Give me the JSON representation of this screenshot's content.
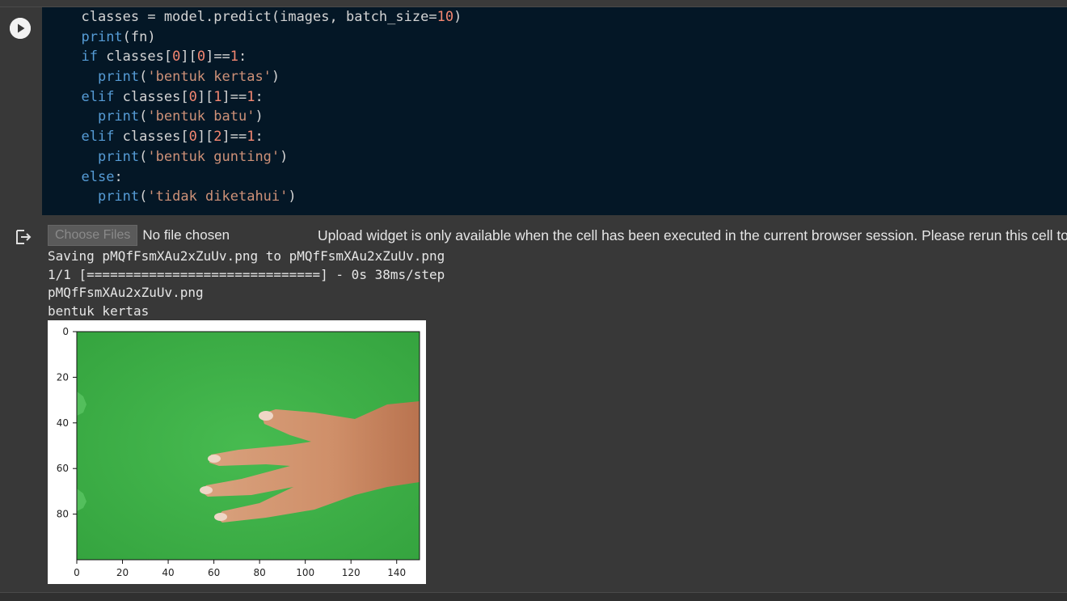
{
  "code_cell": {
    "run_button_icon": "play-icon",
    "lines": [
      [
        {
          "t": "  classes = model.predict(images, batch_size=",
          "c": "op"
        },
        {
          "t": "10",
          "c": "num"
        },
        {
          "t": ")",
          "c": "op"
        }
      ],
      [
        {
          "t": "  ",
          "c": "op"
        },
        {
          "t": "print",
          "c": "bi"
        },
        {
          "t": "(fn)",
          "c": "op"
        }
      ],
      [
        {
          "t": "  ",
          "c": "op"
        },
        {
          "t": "if",
          "c": "bi"
        },
        {
          "t": " classes[",
          "c": "op"
        },
        {
          "t": "0",
          "c": "num"
        },
        {
          "t": "][",
          "c": "op"
        },
        {
          "t": "0",
          "c": "num"
        },
        {
          "t": "]==",
          "c": "op"
        },
        {
          "t": "1",
          "c": "num"
        },
        {
          "t": ":",
          "c": "op"
        }
      ],
      [
        {
          "t": "    ",
          "c": "op"
        },
        {
          "t": "print",
          "c": "bi"
        },
        {
          "t": "(",
          "c": "op"
        },
        {
          "t": "'bentuk kertas'",
          "c": "str"
        },
        {
          "t": ")",
          "c": "op"
        }
      ],
      [
        {
          "t": "  ",
          "c": "op"
        },
        {
          "t": "elif",
          "c": "bi"
        },
        {
          "t": " classes[",
          "c": "op"
        },
        {
          "t": "0",
          "c": "num"
        },
        {
          "t": "][",
          "c": "op"
        },
        {
          "t": "1",
          "c": "num"
        },
        {
          "t": "]==",
          "c": "op"
        },
        {
          "t": "1",
          "c": "num"
        },
        {
          "t": ":",
          "c": "op"
        }
      ],
      [
        {
          "t": "    ",
          "c": "op"
        },
        {
          "t": "print",
          "c": "bi"
        },
        {
          "t": "(",
          "c": "op"
        },
        {
          "t": "'bentuk batu'",
          "c": "str"
        },
        {
          "t": ")",
          "c": "op"
        }
      ],
      [
        {
          "t": "  ",
          "c": "op"
        },
        {
          "t": "elif",
          "c": "bi"
        },
        {
          "t": " classes[",
          "c": "op"
        },
        {
          "t": "0",
          "c": "num"
        },
        {
          "t": "][",
          "c": "op"
        },
        {
          "t": "2",
          "c": "num"
        },
        {
          "t": "]==",
          "c": "op"
        },
        {
          "t": "1",
          "c": "num"
        },
        {
          "t": ":",
          "c": "op"
        }
      ],
      [
        {
          "t": "    ",
          "c": "op"
        },
        {
          "t": "print",
          "c": "bi"
        },
        {
          "t": "(",
          "c": "op"
        },
        {
          "t": "'bentuk gunting'",
          "c": "str"
        },
        {
          "t": ")",
          "c": "op"
        }
      ],
      [
        {
          "t": "  ",
          "c": "op"
        },
        {
          "t": "else",
          "c": "bi"
        },
        {
          "t": ":",
          "c": "op"
        }
      ],
      [
        {
          "t": "    ",
          "c": "op"
        },
        {
          "t": "print",
          "c": "bi"
        },
        {
          "t": "(",
          "c": "op"
        },
        {
          "t": "'tidak diketahui'",
          "c": "str"
        },
        {
          "t": ")",
          "c": "op"
        }
      ]
    ]
  },
  "output": {
    "icon": "output-redirect-icon",
    "upload": {
      "choose_files_label": "Choose Files",
      "no_file_text": "No file chosen",
      "widget_message": "Upload widget is only available when the cell has been executed in the current browser session. Please rerun this cell to enable."
    },
    "stdout_lines": [
      "Saving pMQfFsmXAu2xZuUv.png to pMQfFsmXAu2xZuUv.png",
      "1/1 [==============================] - 0s 38ms/step",
      "pMQfFsmXAu2xZuUv.png",
      "bentuk kertas"
    ]
  },
  "figure": {
    "x_ticks": [
      "0",
      "20",
      "40",
      "60",
      "80",
      "100",
      "120",
      "140"
    ],
    "y_ticks": [
      "0",
      "20",
      "40",
      "60",
      "80"
    ],
    "x_range": [
      0,
      150
    ],
    "y_range": [
      0,
      100
    ],
    "background_color": "#3dae47"
  },
  "colors": {
    "editor_bg": "#041726",
    "page_bg": "#383838",
    "keyword": "#569cd6",
    "number": "#f48771",
    "string": "#ce9178"
  }
}
